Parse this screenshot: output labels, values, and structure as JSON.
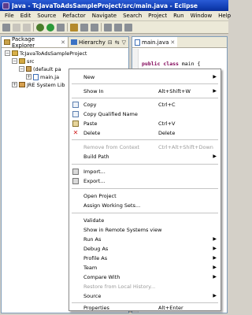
{
  "window": {
    "title": "Java - TcJavaToAdsSampleProject/src/main.java - Eclipse"
  },
  "menubar": [
    "File",
    "Edit",
    "Source",
    "Refactor",
    "Navigate",
    "Search",
    "Project",
    "Run",
    "Window",
    "Help"
  ],
  "explorer": {
    "tab_label": "Package Explorer",
    "close_glyph": "✕",
    "hierarchy_tab": "Hierarchy",
    "tree": {
      "project": "TcJavaToAdsSampleProject",
      "src": "src",
      "default_package": "(default pa",
      "main_java": "main.ja",
      "jre": "JRE System Lib"
    }
  },
  "editor": {
    "tab_label": "main.java",
    "close_glyph": "✕",
    "code_keywords": "public class",
    "code_rest": "main {"
  },
  "context_menu": {
    "items": [
      {
        "label": "New",
        "shortcut": "",
        "submenu": true,
        "disabled": false,
        "icon": ""
      },
      {
        "label": "Show In",
        "shortcut": "Alt+Shift+W",
        "submenu": true,
        "disabled": false,
        "icon": ""
      },
      {
        "label": "Copy",
        "shortcut": "Ctrl+C",
        "submenu": false,
        "disabled": false,
        "icon": "copy-icon"
      },
      {
        "label": "Copy Qualified Name",
        "shortcut": "",
        "submenu": false,
        "disabled": false,
        "icon": "copy-qualified-name-icon"
      },
      {
        "label": "Paste",
        "shortcut": "Ctrl+V",
        "submenu": false,
        "disabled": false,
        "icon": "paste-icon"
      },
      {
        "label": "Delete",
        "shortcut": "Delete",
        "submenu": false,
        "disabled": false,
        "icon": "delete-icon"
      },
      {
        "label": "Remove from Context",
        "shortcut": "Ctrl+Alt+Shift+Down",
        "submenu": false,
        "disabled": true,
        "icon": ""
      },
      {
        "label": "Build Path",
        "shortcut": "",
        "submenu": true,
        "disabled": false,
        "icon": ""
      },
      {
        "label": "Import...",
        "shortcut": "",
        "submenu": false,
        "disabled": false,
        "icon": "import-icon"
      },
      {
        "label": "Export...",
        "shortcut": "",
        "submenu": false,
        "disabled": false,
        "icon": "export-icon"
      },
      {
        "label": "Open Project",
        "shortcut": "",
        "submenu": false,
        "disabled": false,
        "icon": ""
      },
      {
        "label": "Assign Working Sets...",
        "shortcut": "",
        "submenu": false,
        "disabled": false,
        "icon": ""
      },
      {
        "label": "Validate",
        "shortcut": "",
        "submenu": false,
        "disabled": false,
        "icon": ""
      },
      {
        "label": "Show in Remote Systems view",
        "shortcut": "",
        "submenu": false,
        "disabled": false,
        "icon": ""
      },
      {
        "label": "Run As",
        "shortcut": "",
        "submenu": true,
        "disabled": false,
        "icon": ""
      },
      {
        "label": "Debug As",
        "shortcut": "",
        "submenu": true,
        "disabled": false,
        "icon": ""
      },
      {
        "label": "Profile As",
        "shortcut": "",
        "submenu": true,
        "disabled": false,
        "icon": ""
      },
      {
        "label": "Team",
        "shortcut": "",
        "submenu": true,
        "disabled": false,
        "icon": ""
      },
      {
        "label": "Compare With",
        "shortcut": "",
        "submenu": true,
        "disabled": false,
        "icon": ""
      },
      {
        "label": "Restore from Local History...",
        "shortcut": "",
        "submenu": false,
        "disabled": true,
        "icon": ""
      },
      {
        "label": "Source",
        "shortcut": "",
        "submenu": true,
        "disabled": false,
        "icon": ""
      },
      {
        "label": "Properties",
        "shortcut": "Alt+Enter",
        "submenu": false,
        "disabled": false,
        "icon": ""
      }
    ],
    "submenu_glyph": "▶"
  }
}
